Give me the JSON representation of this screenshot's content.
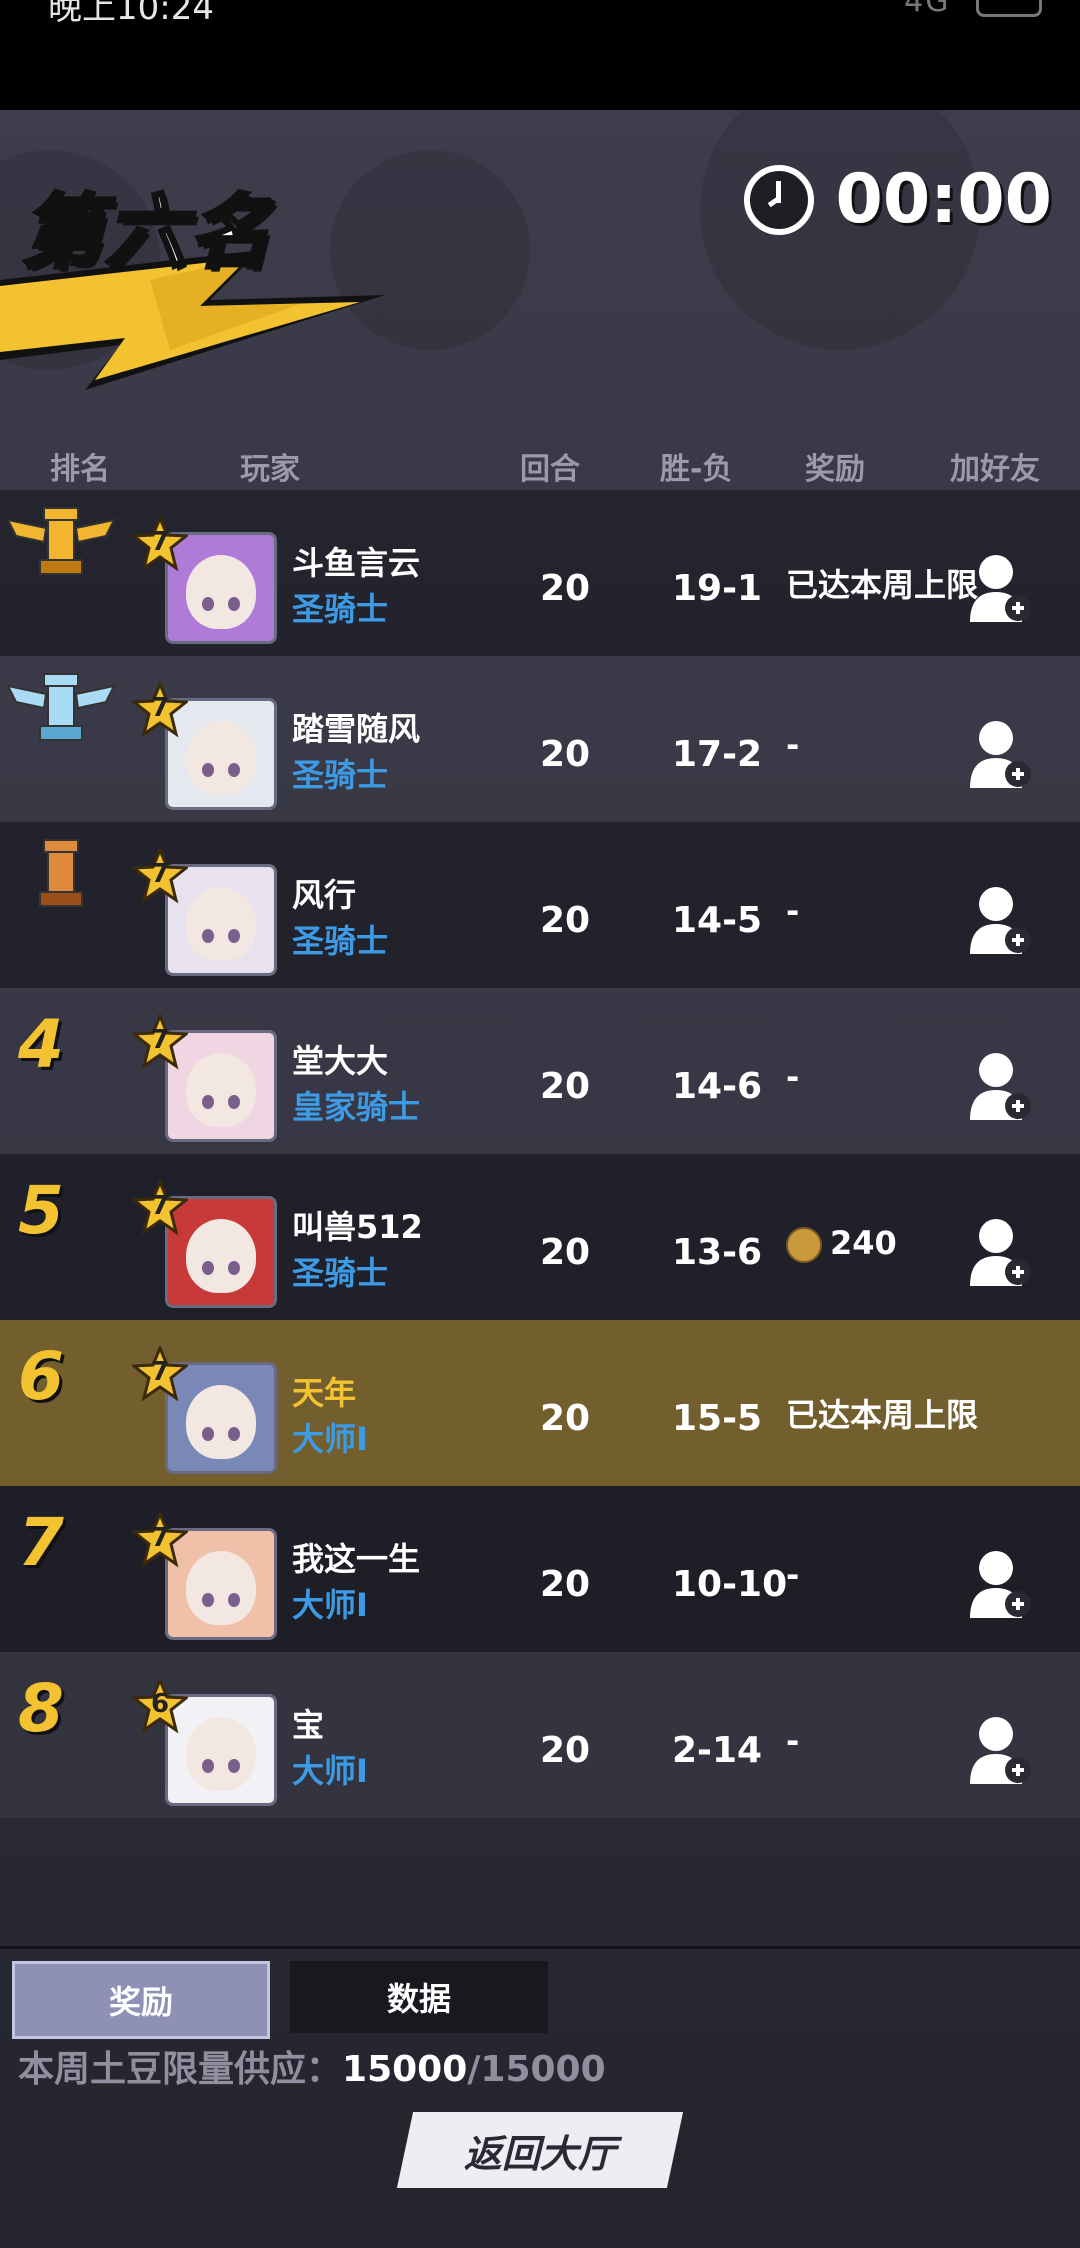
{
  "status_bar": {
    "time": "晚上10:24",
    "signal": "4G"
  },
  "header": {
    "placement": "第六名",
    "timer": "00:00"
  },
  "columns": [
    "排名",
    "玩家",
    "回合",
    "胜-负",
    "奖励",
    "加好友"
  ],
  "players": [
    {
      "rank": "1",
      "rank_icon": "gold-winged-rook-trophy",
      "level": "7",
      "name": "斗鱼言云",
      "title": "圣骑士",
      "rounds": "20",
      "wl": "19-1",
      "reward": "已达本周上限",
      "add_friend": true
    },
    {
      "rank": "2",
      "rank_icon": "silver-winged-rook-trophy",
      "level": "7",
      "name": "踏雪随风",
      "title": "圣骑士",
      "rounds": "20",
      "wl": "17-2",
      "reward": "-",
      "add_friend": true
    },
    {
      "rank": "3",
      "rank_icon": "bronze-rook-trophy",
      "level": "7",
      "name": "风行",
      "title": "圣骑士",
      "rounds": "20",
      "wl": "14-5",
      "reward": "-",
      "add_friend": true
    },
    {
      "rank": "4",
      "level": "7",
      "name": "堂大大",
      "title": "皇家骑士",
      "rounds": "20",
      "wl": "14-6",
      "reward": "-",
      "add_friend": true
    },
    {
      "rank": "5",
      "level": "7",
      "name": "叫兽512",
      "title": "圣骑士",
      "rounds": "20",
      "wl": "13-6",
      "reward": "240",
      "add_friend": true
    },
    {
      "rank": "6",
      "level": "7",
      "name": "天年",
      "title": "大师I",
      "rounds": "20",
      "wl": "15-5",
      "reward": "已达本周上限",
      "add_friend": false
    },
    {
      "rank": "7",
      "level": "7",
      "name": "我这一生",
      "title": "大师I",
      "rounds": "20",
      "wl": "10-10",
      "reward": "-",
      "add_friend": true
    },
    {
      "rank": "8",
      "level": "6",
      "name": "宝",
      "title": "大师I",
      "rounds": "20",
      "wl": "2-14",
      "reward": "-",
      "add_friend": true
    }
  ],
  "tabs": {
    "reward": "奖励",
    "data": "数据"
  },
  "supply": {
    "label": "本周土豆限量供应：",
    "current": "15000",
    "max": "/15000"
  },
  "back_button": "返回大厅",
  "colors": {
    "gold": "#f2c230",
    "title_blue": "#3c9be4",
    "highlight_row": "#735f2e"
  }
}
